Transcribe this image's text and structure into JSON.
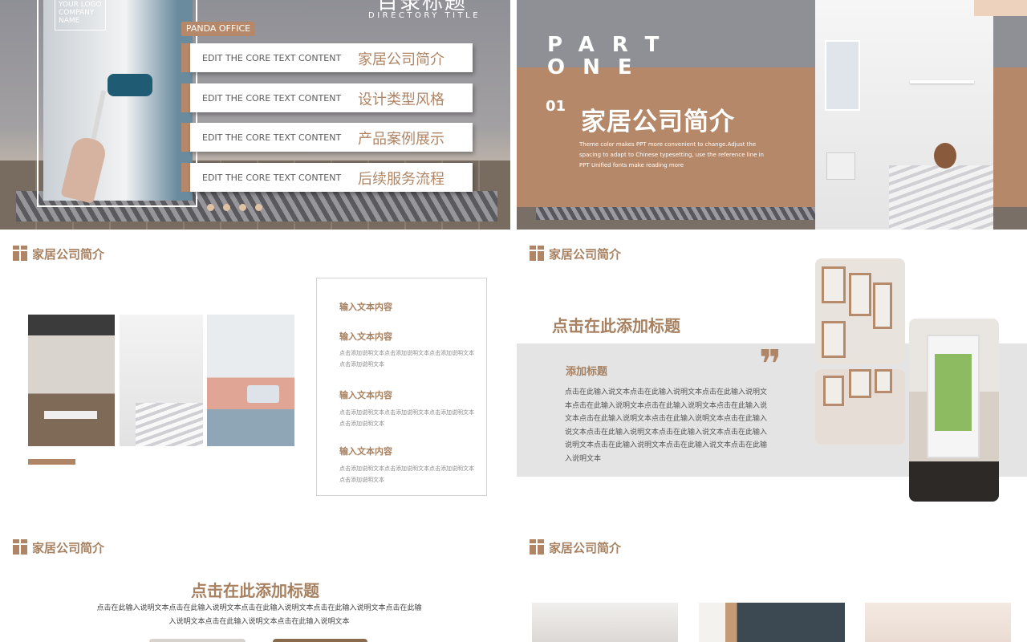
{
  "slide1": {
    "logo_text": "YOUR LOGO\nCOMPANY\nNAME",
    "title": "目录标题",
    "subtitle": "DIRECTORY TITLE",
    "badge": "PANDA OFFICE",
    "menu": [
      {
        "en": "EDIT THE CORE TEXT CONTENT",
        "zh": "家居公司简介"
      },
      {
        "en": "EDIT THE CORE TEXT CONTENT",
        "zh": "设计类型风格"
      },
      {
        "en": "EDIT THE CORE TEXT CONTENT",
        "zh": "产品案例展示"
      },
      {
        "en": "EDIT THE CORE TEXT CONTENT",
        "zh": "后续服务流程"
      }
    ]
  },
  "slide2": {
    "part": "PART\nONE",
    "number": "01",
    "title": "家居公司简介",
    "description": "Theme color makes PPT more convenient to change.Adjust the spacing to adapt to Chinese typesetting, use the reference line in PPT Unified fonts make reading more"
  },
  "slide3": {
    "section": "家居公司简介",
    "box_title": "输入文本内容",
    "items": [
      {
        "heading": "输入文本内容",
        "text": "点击添加说明文本点击添加说明文本点击添加说明文本点击添加说明文本"
      },
      {
        "heading": "输入文本内容",
        "text": "点击添加说明文本点击添加说明文本点击添加说明文本点击添加说明文本"
      },
      {
        "heading": "输入文本内容",
        "text": "点击添加说明文本点击添加说明文本点击添加说明文本点击添加说明文本"
      }
    ]
  },
  "slide4": {
    "section": "家居公司简介",
    "title": "点击在此添加标题",
    "subtitle": "添加标题",
    "quote_mark": "❞",
    "body": "点击在此输入说文本点击在此输入说明文本点击在此输入说明文本点击在此输入说明文本点击在此输入说明文本点击在此输入说文本点击在此输入说明文本点击在此输入说明文本点击在此输入说文本点击在此输入说明文本点击在此输入说文本点击在此输入说明文本点击在此输入说明文本点击在此输入说文本点击在此输入说明文本"
  },
  "slide5": {
    "section": "家居公司简介",
    "title": "点击在此添加标题",
    "body": "点击在此输入说明文本点击在此输入说明文本点击在此输入说明文本点击在此输入说明文本点击在此输入说明文本点击在此输入说明文本点击在此输入说明文本"
  },
  "slide6": {
    "section": "家居公司简介"
  },
  "colors": {
    "accent": "#b08565",
    "accent_dark": "#a7805f",
    "panel_gray": "#e4e4e4"
  }
}
